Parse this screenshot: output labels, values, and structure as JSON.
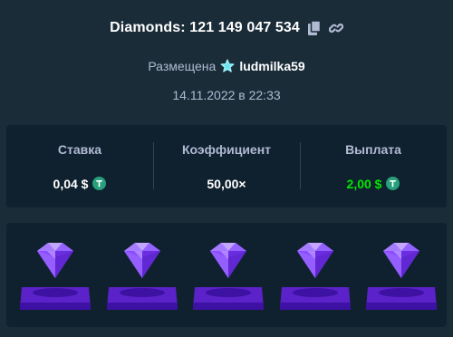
{
  "header": {
    "title": "Diamonds: 121 149 047 534",
    "copy_icon": "copy-icon",
    "link_icon": "link-icon"
  },
  "placed": {
    "label": "Размещена",
    "username": "ludmilka59",
    "badge_icon": "star-badge-icon"
  },
  "date": "14.11.2022 в 22:33",
  "stats": {
    "bet_label": "Ставка",
    "bet_value": "0,04 $",
    "multiplier_label": "Коэффициент",
    "multiplier_value": "50,00×",
    "payout_label": "Выплата",
    "payout_value": "2,00 $",
    "currency_icon": "tether-coin-icon",
    "payout_color": "#00e701"
  },
  "board": {
    "gems": [
      "purple-diamond",
      "purple-diamond",
      "purple-diamond",
      "purple-diamond",
      "purple-diamond"
    ],
    "gem_color": "#8b4dff"
  },
  "colors": {
    "background": "#1a2c38",
    "panel": "#0f212e",
    "muted_text": "#b1bad3",
    "accent_green": "#00e701",
    "tether": "#26a17b"
  }
}
